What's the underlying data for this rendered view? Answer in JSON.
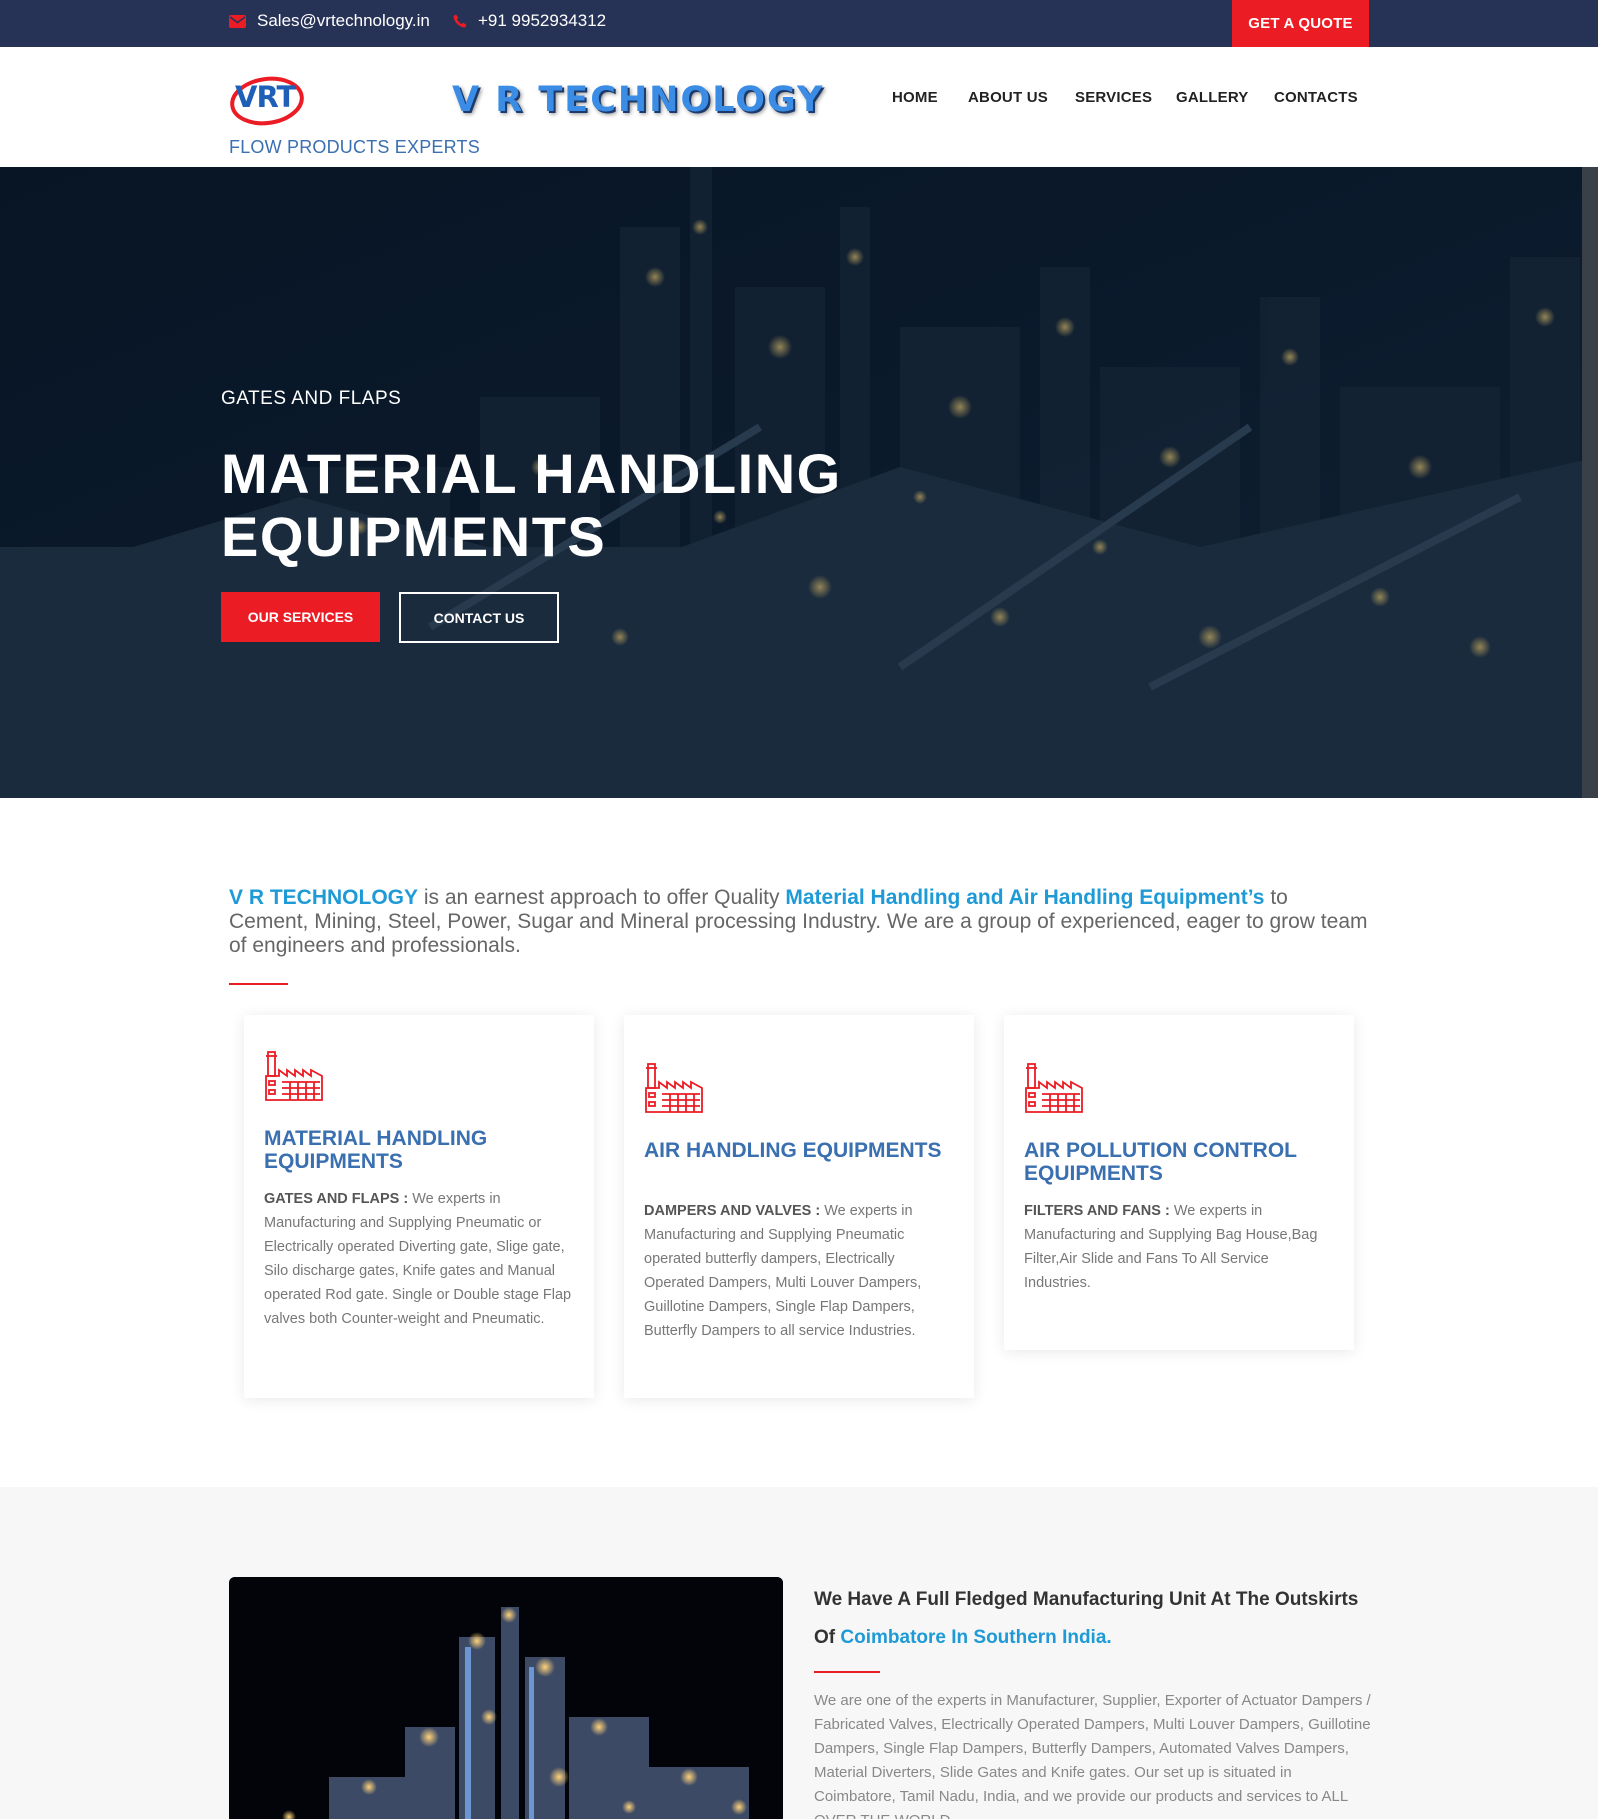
{
  "topbar": {
    "email": "Sales@vrtechnology.in",
    "phone": "+91 9952934312",
    "quote_label": "GET A QUOTE"
  },
  "header": {
    "logo_text": "VRT",
    "tagline": "FLOW PRODUCTS EXPERTS",
    "brand_title": "V R TECHNOLOGY",
    "nav": [
      "HOME",
      "ABOUT US",
      "SERVICES",
      "GALLERY",
      "CONTACTS"
    ]
  },
  "hero": {
    "subtitle": "GATES AND FLAPS",
    "title_line1": "MATERIAL HANDLING",
    "title_line2": "EQUIPMENTS",
    "btn_services": "OUR SERVICES",
    "btn_contact": "CONTACT US"
  },
  "intro": {
    "brand": "V R TECHNOLOGY",
    "text_a": " is an earnest approach to offer Quality ",
    "highlight": "Material Handling and Air Handling Equipment’s",
    "text_b": " to Cement, Mining, Steel, Power, Sugar and Mineral processing Industry. We are a group of experienced, eager to grow team of engineers and professionals."
  },
  "cards": [
    {
      "icon": "factory-icon",
      "title": "MATERIAL HANDLING EQUIPMENTS",
      "lead": "GATES AND FLAPS : ",
      "body": "We experts in Manufacturing and Supplying Pneumatic or Electrically operated Diverting gate, Slige gate, Silo discharge gates, Knife gates and Manual operated Rod gate. Single or Double stage Flap valves both Counter-weight and Pneumatic."
    },
    {
      "icon": "factory-icon",
      "title": "AIR HANDLING EQUIPMENTS",
      "lead": "DAMPERS AND VALVES : ",
      "body": "We experts in Manufacturing and Supplying Pneumatic operated butterfly dampers, Electrically Operated Dampers, Multi Louver Dampers, Guillotine Dampers, Single Flap Dampers, Butterfly Dampers to all service Industries."
    },
    {
      "icon": "factory-icon",
      "title": "AIR POLLUTION CONTROL EQUIPMENTS",
      "lead": "FILTERS AND FANS : ",
      "body": "We experts in Manufacturing and Supplying Bag House,Bag Filter,Air Slide and Fans To All Service Industries."
    }
  ],
  "section2": {
    "heading_a": "We Have A Full Fledged Manufacturing Unit At The Outskirts Of ",
    "heading_hl": "Coimbatore In Southern India.",
    "text": "We are one of the experts in Manufacturer, Supplier, Exporter of Actuator Dampers / Fabricated Valves, Electrically Operated Dampers, Multi Louver Dampers, Guillotine Dampers, Single Flap Dampers, Butterfly Dampers, Automated Valves Dampers, Material Diverters, Slide Gates and Knife gates. Our set up is situated in Coimbatore, Tamil Nadu, India, and we provide our products and services to ALL OVER THE WORLD."
  },
  "colors": {
    "topbar": "#263357",
    "accent_red": "#ec1c24",
    "brand_blue": "#1e9ad6",
    "card_title_blue": "#3a6fb0"
  }
}
